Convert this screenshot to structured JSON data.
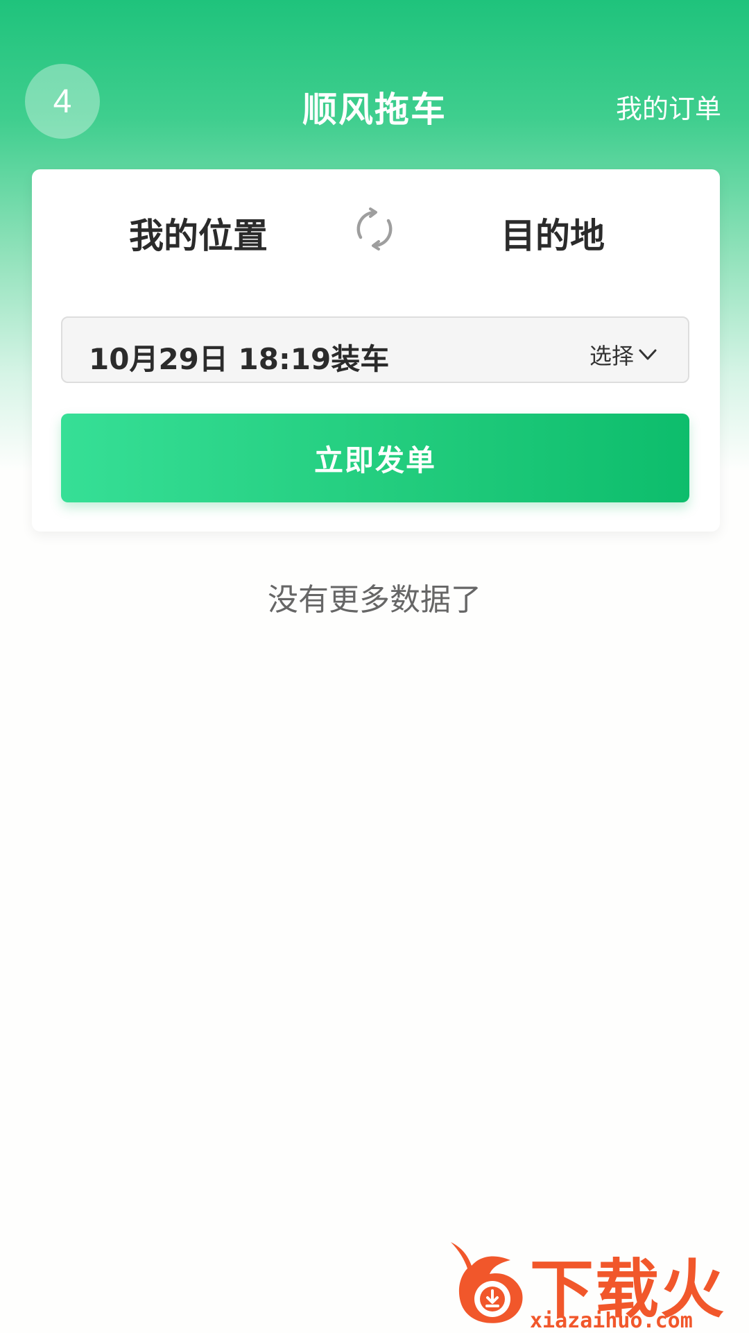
{
  "header": {
    "avatar_text": "4",
    "title": "顺风拖车",
    "my_orders": "我的订单"
  },
  "card": {
    "origin": "我的位置",
    "destination": "目的地",
    "swap_icon": "swap-refresh-icon",
    "time_text": "10月29日 18:19装车",
    "select_label": "选择",
    "submit_label": "立即发单"
  },
  "list": {
    "empty_text": "没有更多数据了"
  },
  "watermark": {
    "title": "下载火",
    "url": "xiazaihuo.com"
  },
  "colors": {
    "brand_green": "#1fc37c",
    "button_start": "#36df96",
    "button_end": "#0dbd6c",
    "watermark_orange": "#f1572b"
  }
}
